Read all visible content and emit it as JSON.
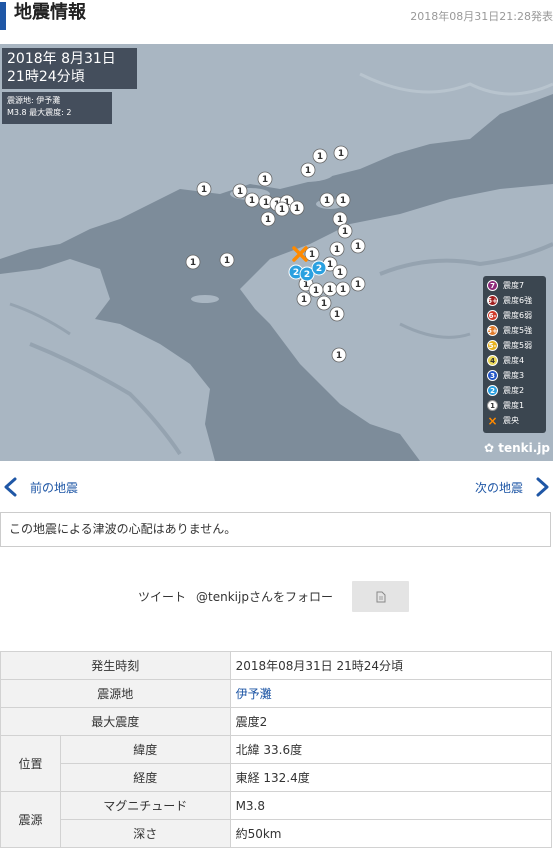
{
  "header": {
    "title": "地震情報",
    "timestamp": "2018年08月31日21:28発表"
  },
  "map": {
    "datetime_line1": "2018年  8月31日",
    "datetime_line2": "21時24分頃",
    "epicenter_line": "震源地: 伊予灘",
    "magnitude_line": "M3.8    最大震度: 2",
    "legend": [
      {
        "symbol": "7",
        "label": "震度7",
        "color": "#8e2a7a"
      },
      {
        "symbol": "6+",
        "label": "震度6強",
        "color": "#a01e1e"
      },
      {
        "symbol": "6-",
        "label": "震度6弱",
        "color": "#d03a2a"
      },
      {
        "symbol": "5+",
        "label": "震度5強",
        "color": "#e07a2a"
      },
      {
        "symbol": "5-",
        "label": "震度5弱",
        "color": "#e8b21e"
      },
      {
        "symbol": "4",
        "label": "震度4",
        "color": "#e8d65a"
      },
      {
        "symbol": "3",
        "label": "震度3",
        "color": "#2255c8"
      },
      {
        "symbol": "2",
        "label": "震度2",
        "color": "#2aa0e0"
      },
      {
        "symbol": "1",
        "label": "震度1",
        "color": "#ffffff"
      },
      {
        "symbol": "×",
        "label": "震央",
        "color": "#ff8a00"
      }
    ],
    "brand": "tenki.jp"
  },
  "nav": {
    "prev": "前の地震",
    "next": "次の地震"
  },
  "notice": "この地震による津波の心配はありません。",
  "social": {
    "tweet": "ツイート",
    "follow": "@tenkijpさんをフォロー"
  },
  "table": {
    "occurred_label": "発生時刻",
    "occurred_value": "2018年08月31日 21時24分頃",
    "epicenter_label": "震源地",
    "epicenter_value": "伊予灘",
    "max_intensity_label": "最大震度",
    "max_intensity_value": "震度2",
    "position_label": "位置",
    "lat_label": "緯度",
    "lat_value": "北緯 33.6度",
    "lon_label": "経度",
    "lon_value": "東経 132.4度",
    "source_label": "震源",
    "magnitude_label": "マグニチュード",
    "magnitude_value": "M3.8",
    "depth_label": "深さ",
    "depth_value": "約50km"
  }
}
